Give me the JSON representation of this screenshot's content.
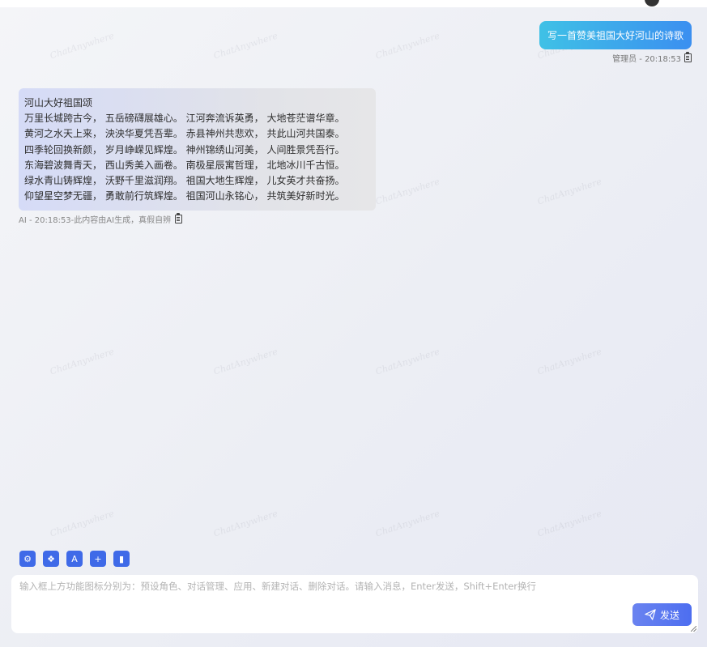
{
  "watermark_text": "ChatAnywhere",
  "colors": {
    "user_bubble_start": "#3fc1e6",
    "user_bubble_end": "#3b8ff0",
    "tool_button": "#3f6ae8",
    "send_button": "#4d6ef0"
  },
  "chat": {
    "user_message": {
      "text": "写一首赞美祖国大好河山的诗歌",
      "meta": "管理员 - 20:18:53",
      "copy_icon": "clipboard-icon"
    },
    "ai_message": {
      "lines": [
        "河山大好祖国颂",
        "万里长城跨古今， 五岳磅礴展雄心。 江河奔流诉英勇， 大地苍茫谱华章。",
        "黄河之水天上来， 泱泱华夏凭吾辈。 赤县神州共悲欢， 共此山河共国泰。",
        "四季轮回换新颜， 岁月峥嵘见辉煌。 神州锦绣山河美， 人间胜景凭吾行。",
        "东海碧波舞青天， 西山秀美入画卷。 南极星辰寓哲理， 北地冰川千古恒。",
        "绿水青山铸辉煌， 沃野千里滋润翔。 祖国大地生辉煌， 儿女英才共奋扬。",
        "仰望星空梦无疆， 勇敢前行筑辉煌。 祖国河山永铭心， 共筑美好新时光。"
      ],
      "meta": "AI - 20:18:53-此内容由AI生成，真假自辨",
      "copy_icon": "clipboard-icon"
    }
  },
  "toolbar": {
    "buttons": [
      {
        "name": "preset-role",
        "icon": "gear-icon",
        "glyph": "⚙"
      },
      {
        "name": "conversation-manage",
        "icon": "chat-bubbles-icon",
        "glyph": "❖"
      },
      {
        "name": "apps",
        "icon": "app-store-icon",
        "glyph": "A"
      },
      {
        "name": "new-chat",
        "icon": "add-chat-icon",
        "glyph": "+"
      },
      {
        "name": "delete-chat",
        "icon": "trash-icon",
        "glyph": "▮"
      }
    ]
  },
  "composer": {
    "placeholder": "输入框上方功能图标分别为：预设角色、对话管理、应用、新建对话、删除对话。请输入消息，Enter发送，Shift+Enter换行",
    "value": "",
    "send_label": "发送",
    "send_icon": "paper-plane-icon"
  }
}
